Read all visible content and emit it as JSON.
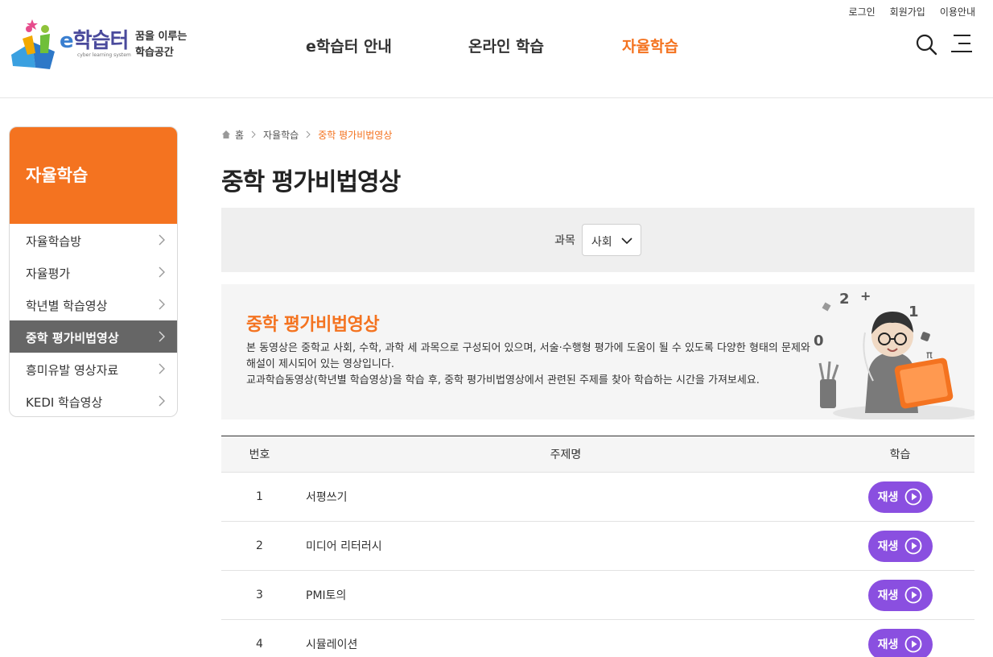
{
  "header": {
    "util_links": [
      "로그인",
      "회원가입",
      "이용안내"
    ],
    "logo": {
      "brand_e": "e",
      "brand_rest": "학습터",
      "sub": "cyber learning system",
      "slogan_line1": "꿈을 이루는",
      "slogan_line2": "학습공간"
    },
    "gnb": [
      "e학습터 안내",
      "온라인 학습",
      "자율학습"
    ],
    "gnb_active": "자율학습"
  },
  "sidebar": {
    "title": "자율학습",
    "items": [
      {
        "label": "자율학습방",
        "active": false
      },
      {
        "label": "자율평가",
        "active": false
      },
      {
        "label": "학년별 학습영상",
        "active": false
      },
      {
        "label": "중학 평가비법영상",
        "active": true
      },
      {
        "label": "흥미유발 영상자료",
        "active": false
      },
      {
        "label": "KEDI 학습영상",
        "active": false
      }
    ]
  },
  "breadcrumb": {
    "home": "홈",
    "level1": "자율학습",
    "current": "중학 평가비법영상"
  },
  "page_title": "중학 평가비법영상",
  "filter": {
    "label": "과목",
    "selected": "사회"
  },
  "intro": {
    "title": "중학 평가비법영상",
    "desc_line1": "본 동영상은 중학교 사회, 수학, 과학 세 과목으로 구성되어 있으며, 서술·수행형 평가에 도움이 될 수 있도록 다양한 형태의 문제와 해설이 제시되어 있는 영상입니다.",
    "desc_line2": "교과학습동영상(학년별 학습영상)을 학습 후, 중학 평가비법영상에서 관련된 주제를 찾아 학습하는 시간을 가져보세요."
  },
  "table": {
    "headers": [
      "번호",
      "주제명",
      "학습"
    ],
    "rows": [
      {
        "no": "1",
        "title": "서평쓰기",
        "action": "재생"
      },
      {
        "no": "2",
        "title": "미디어 리터러시",
        "action": "재생"
      },
      {
        "no": "3",
        "title": "PMI토의",
        "action": "재생"
      },
      {
        "no": "4",
        "title": "시뮬레이션",
        "action": "재생"
      }
    ]
  },
  "colors": {
    "accent_orange": "#f47320",
    "play_purple": "#8a4fe0",
    "active_gray": "#666666"
  }
}
